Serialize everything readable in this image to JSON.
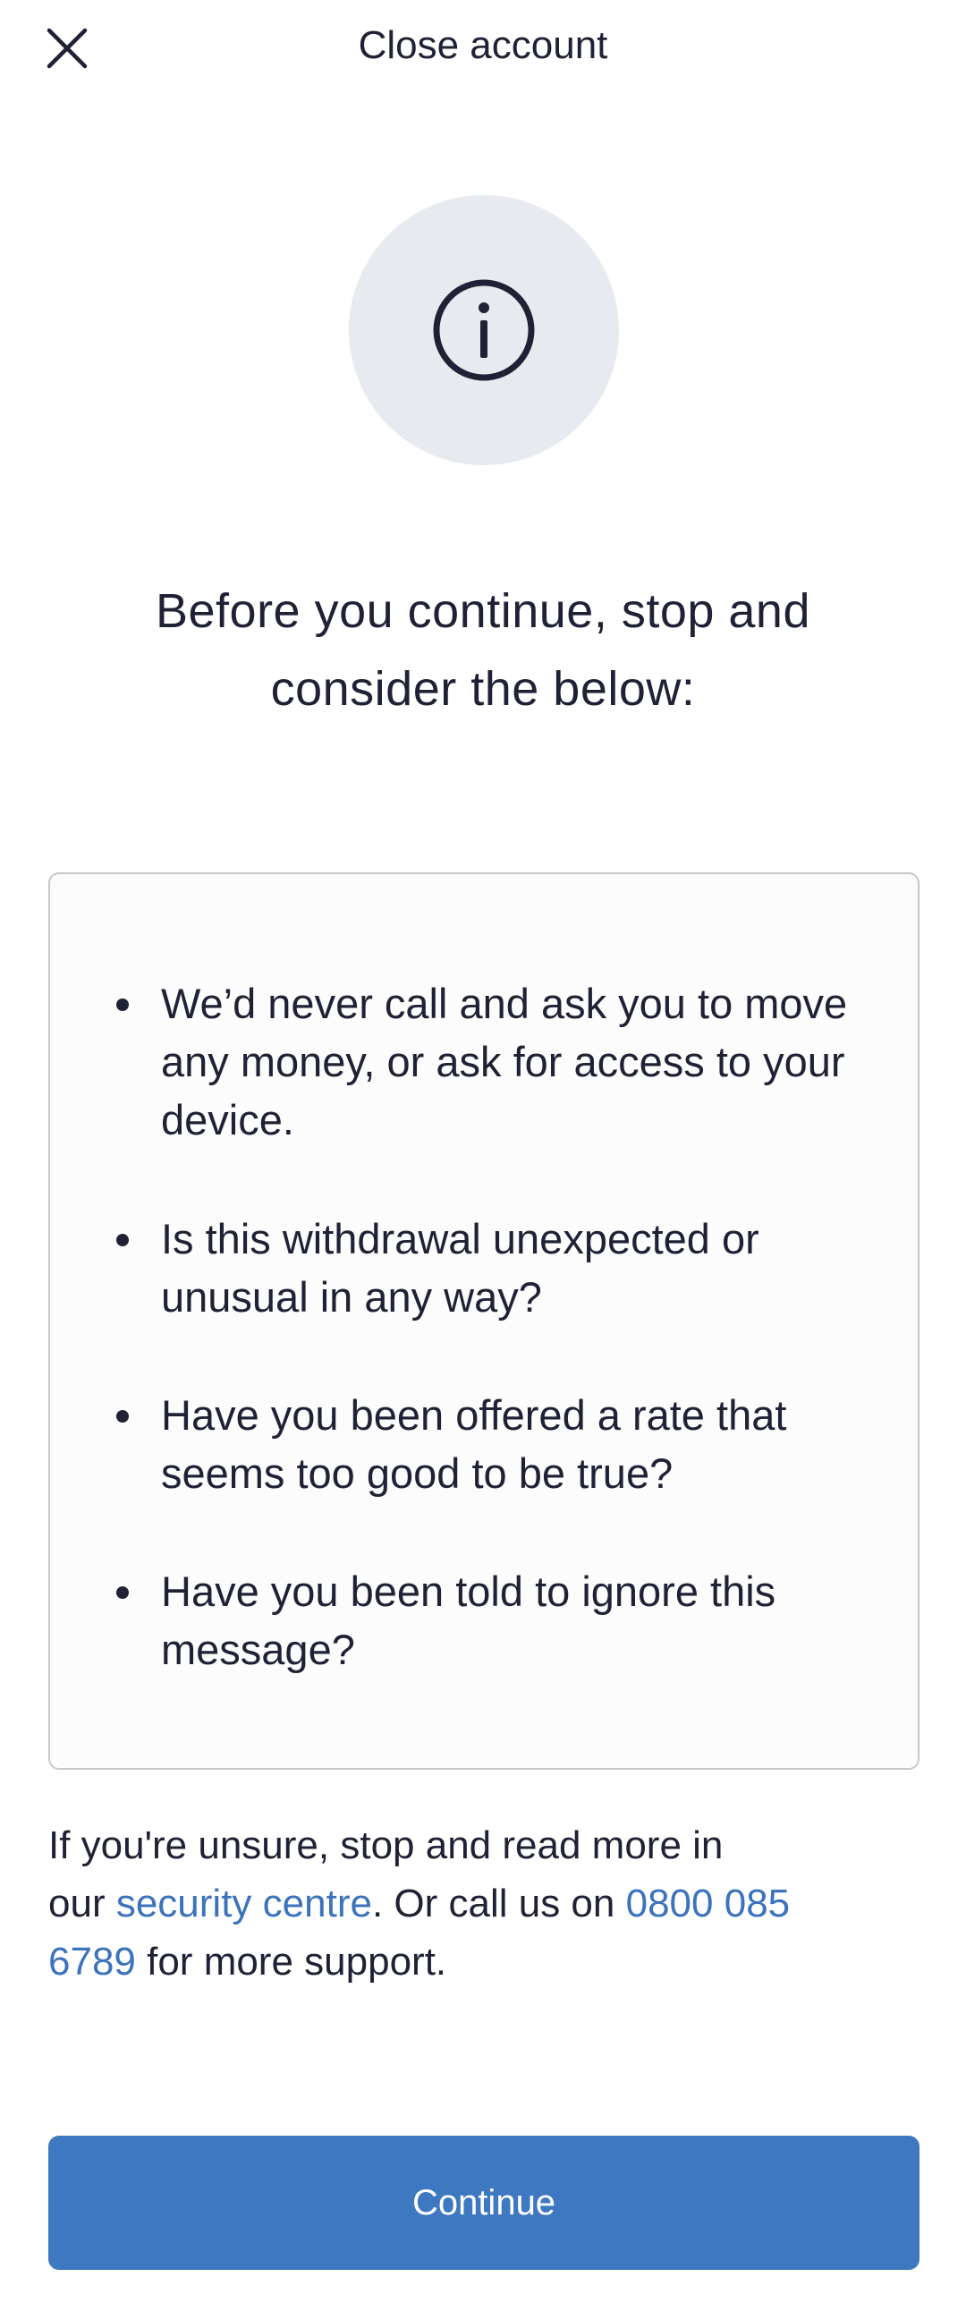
{
  "header": {
    "title": "Close account",
    "close_icon": "close-icon"
  },
  "hero": {
    "icon": "info-icon",
    "circle_color": "#e7ebf0"
  },
  "heading": {
    "line1": "Before you continue, stop and",
    "line2": "consider the below:"
  },
  "notice": {
    "items": [
      {
        "label": "We’d never call and ask you to move any money, or ask for access to your device."
      },
      {
        "label": "Is this withdrawal unexpected or unusual in any way?"
      },
      {
        "label": "Have you been offered a rate that seems too good to be true?"
      },
      {
        "label": "Have you been told to ignore this message?"
      }
    ]
  },
  "support": {
    "line1": "If you're unsure, stop and read more in",
    "prefix": "our ",
    "security_link": "security centre",
    "middle": ". Or call us on ",
    "phone_link_part1": "0800 085",
    "phone_link_part2": "6789",
    "suffix": " for more support."
  },
  "continue_button": {
    "label": "Continue"
  },
  "colors": {
    "text": "#1f2235",
    "accent": "#3e78c0",
    "link": "#3c73bb",
    "box_border": "#c7c8cc",
    "box_background": "#fcfcfc"
  }
}
